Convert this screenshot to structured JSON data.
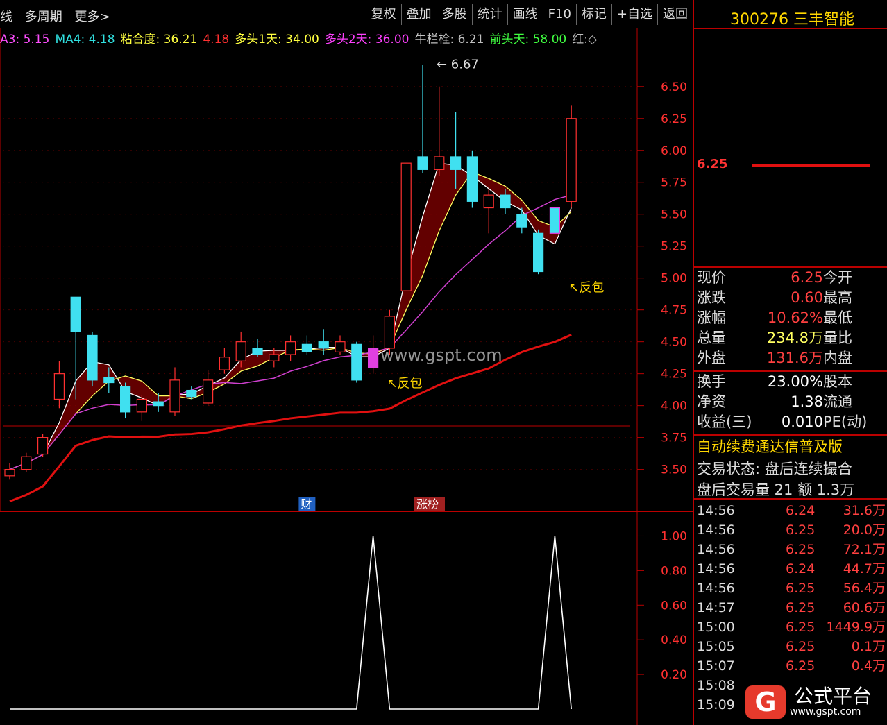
{
  "toolbar": {
    "left_items": [
      "线",
      "多周期",
      "更多>"
    ],
    "buttons": [
      "复权",
      "叠加",
      "多股",
      "统计",
      "画线",
      "F10",
      "标记",
      "+自选",
      "返回"
    ]
  },
  "legend": [
    {
      "text": "A3: 5.15",
      "color": "#ff4fff"
    },
    {
      "text": "MA4: 4.18",
      "color": "#30e0e0"
    },
    {
      "text": "粘合度: 36.21",
      "color": "#ffff40"
    },
    {
      "text": "4.18",
      "color": "#ff3030"
    },
    {
      "text": "多头1天: 34.00",
      "color": "#ffff40"
    },
    {
      "text": "多头2天: 36.00",
      "color": "#ff40ff"
    },
    {
      "text": "牛栏栓: 6.21",
      "color": "#c0c0c0"
    },
    {
      "text": "前头天: 58.00",
      "color": "#40ff40"
    },
    {
      "text": "红:◇",
      "color": "#c0c0c0"
    }
  ],
  "stock": {
    "code": "300276",
    "name": "三丰智能"
  },
  "current_price_label": "6.25",
  "quote": [
    {
      "label": "现价",
      "value": "6.25",
      "label2": "今开",
      "color": "#ff4040"
    },
    {
      "label": "涨跌",
      "value": "0.60",
      "label2": "最高",
      "color": "#ff4040"
    },
    {
      "label": "涨幅",
      "value": "10.62%",
      "label2": "最低",
      "color": "#ff4040"
    },
    {
      "label": "总量",
      "value": "234.8万",
      "label2": "量比",
      "color": "#ffff60"
    },
    {
      "label": "外盘",
      "value": "131.6万",
      "label2": "内盘",
      "color": "#ff4040"
    }
  ],
  "quote2": [
    {
      "label": "换手",
      "value": "23.00%",
      "label2": "股本",
      "color": "#ffffff"
    },
    {
      "label": "净资",
      "value": "1.38",
      "label2": "流通",
      "color": "#ffffff"
    },
    {
      "label": "收益(三)",
      "value": "0.010",
      "label2": "PE(动)",
      "color": "#ffffff"
    }
  ],
  "notice": "自动续费通达信普及版",
  "trade_status": "交易状态: 盘后连续撮合",
  "after_hours": "盘后交易量 21 额 1.3万",
  "ticks": [
    {
      "time": "14:56",
      "price": "6.24",
      "vol": "31.6万"
    },
    {
      "time": "14:56",
      "price": "6.25",
      "vol": "20.0万"
    },
    {
      "time": "14:56",
      "price": "6.25",
      "vol": "72.1万"
    },
    {
      "time": "14:56",
      "price": "6.24",
      "vol": "44.7万"
    },
    {
      "time": "14:56",
      "price": "6.25",
      "vol": "56.4万"
    },
    {
      "time": "14:57",
      "price": "6.25",
      "vol": "60.6万"
    },
    {
      "time": "15:00",
      "price": "6.25",
      "vol": "1449.9万"
    },
    {
      "time": "15:05",
      "price": "6.25",
      "vol": "0.1万"
    },
    {
      "time": "15:07",
      "price": "6.25",
      "vol": "0.4万"
    },
    {
      "time": "15:08",
      "price": "",
      "vol": ""
    },
    {
      "time": "15:09",
      "price": "",
      "vol": ""
    }
  ],
  "chart_data": {
    "type": "candlestick",
    "price_axis": [
      "6.50",
      "6.25",
      "6.00",
      "5.75",
      "5.50",
      "5.25",
      "5.00",
      "4.75",
      "4.50",
      "4.25",
      "4.00",
      "3.75",
      "3.50"
    ],
    "indicator_axis": [
      "1.00",
      "0.80",
      "0.60",
      "0.40",
      "0.20"
    ],
    "ylim_price": [
      3.4,
      6.7
    ],
    "ylim_indicator": [
      0,
      1.05
    ],
    "annotations": [
      {
        "text": "6.67",
        "at_index": 25,
        "value": 6.67
      },
      {
        "text": "反包",
        "at_index": 22,
        "value": 4.25
      },
      {
        "text": "反包",
        "at_index": 33,
        "value": 5.0
      }
    ],
    "markers": [
      {
        "text": "财",
        "at_index": 18
      },
      {
        "text": "涨榜",
        "at_index": 25
      }
    ],
    "candles": [
      {
        "o": 3.45,
        "c": 3.5,
        "h": 3.55,
        "l": 3.42
      },
      {
        "o": 3.5,
        "c": 3.6,
        "h": 3.63,
        "l": 3.48
      },
      {
        "o": 3.62,
        "c": 3.75,
        "h": 3.78,
        "l": 3.6
      },
      {
        "o": 4.05,
        "c": 4.25,
        "h": 4.35,
        "l": 3.98
      },
      {
        "o": 4.85,
        "c": 4.58,
        "h": 4.85,
        "l": 4.05
      },
      {
        "o": 4.55,
        "c": 4.2,
        "h": 4.58,
        "l": 4.15
      },
      {
        "o": 4.22,
        "c": 4.18,
        "h": 4.3,
        "l": 4.1
      },
      {
        "o": 4.15,
        "c": 3.95,
        "h": 4.18,
        "l": 3.9
      },
      {
        "o": 3.95,
        "c": 4.05,
        "h": 4.08,
        "l": 3.88
      },
      {
        "o": 4.03,
        "c": 4.0,
        "h": 4.1,
        "l": 3.95
      },
      {
        "o": 3.95,
        "c": 4.2,
        "h": 4.3,
        "l": 3.92
      },
      {
        "o": 4.12,
        "c": 4.07,
        "h": 4.15,
        "l": 4.05
      },
      {
        "o": 4.02,
        "c": 4.2,
        "h": 4.28,
        "l": 4.0
      },
      {
        "o": 4.28,
        "c": 4.38,
        "h": 4.45,
        "l": 4.25
      },
      {
        "o": 4.35,
        "c": 4.5,
        "h": 4.58,
        "l": 4.3
      },
      {
        "o": 4.45,
        "c": 4.4,
        "h": 4.52,
        "l": 4.38
      },
      {
        "o": 4.35,
        "c": 4.4,
        "h": 4.45,
        "l": 4.3
      },
      {
        "o": 4.4,
        "c": 4.5,
        "h": 4.55,
        "l": 4.35
      },
      {
        "o": 4.48,
        "c": 4.42,
        "h": 4.55,
        "l": 4.4
      },
      {
        "o": 4.5,
        "c": 4.45,
        "h": 4.6,
        "l": 4.4
      },
      {
        "o": 4.42,
        "c": 4.5,
        "h": 4.55,
        "l": 4.4
      },
      {
        "o": 4.48,
        "c": 4.2,
        "h": 4.5,
        "l": 4.18
      },
      {
        "o": 4.3,
        "c": 4.45,
        "h": 4.55,
        "l": 4.25
      },
      {
        "o": 4.45,
        "c": 4.7,
        "h": 4.75,
        "l": 4.4
      },
      {
        "o": 4.9,
        "c": 5.9,
        "h": 5.9,
        "l": 4.9
      },
      {
        "o": 5.95,
        "c": 5.85,
        "h": 6.67,
        "l": 5.82
      },
      {
        "o": 5.85,
        "c": 5.95,
        "h": 6.5,
        "l": 5.8
      },
      {
        "o": 5.95,
        "c": 5.85,
        "h": 6.3,
        "l": 5.7
      },
      {
        "o": 5.95,
        "c": 5.6,
        "h": 6.0,
        "l": 5.55
      },
      {
        "o": 5.55,
        "c": 5.65,
        "h": 5.7,
        "l": 5.35
      },
      {
        "o": 5.65,
        "c": 5.55,
        "h": 5.7,
        "l": 5.5
      },
      {
        "o": 5.5,
        "c": 5.4,
        "h": 5.55,
        "l": 5.35
      },
      {
        "o": 5.35,
        "c": 5.05,
        "h": 5.38,
        "l": 5.03
      },
      {
        "o": 5.55,
        "c": 5.35,
        "h": 5.55,
        "l": 5.35
      },
      {
        "o": 5.6,
        "c": 6.25,
        "h": 6.35,
        "l": 5.55
      }
    ],
    "indicator": [
      0,
      0,
      0,
      0,
      0,
      0,
      0,
      0,
      0,
      0,
      0,
      0,
      0,
      0,
      0,
      0,
      0,
      0,
      0,
      0,
      0,
      0,
      1,
      0,
      0,
      0,
      0,
      0,
      0,
      0,
      0,
      0,
      0,
      1,
      0
    ]
  }
}
